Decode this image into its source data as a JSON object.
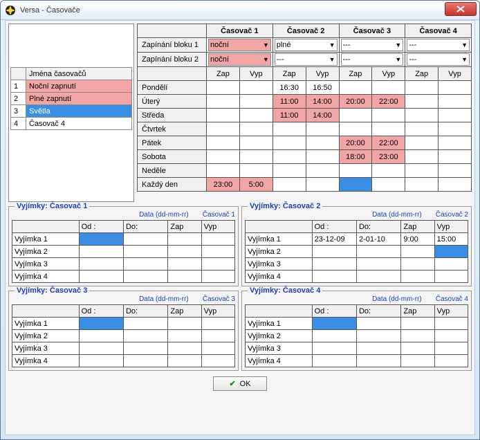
{
  "window": {
    "title": "Versa - Časovače"
  },
  "names": {
    "header": "Jména časovačů",
    "items": [
      {
        "id": "1",
        "label": "Noční zapnutí",
        "style": "red"
      },
      {
        "id": "2",
        "label": "Plné zapnutí",
        "style": "red"
      },
      {
        "id": "3",
        "label": "Světla",
        "style": "blue"
      },
      {
        "id": "4",
        "label": "Časovač 4",
        "style": ""
      }
    ]
  },
  "schedule": {
    "timers": [
      "Časovač 1",
      "Časovač 2",
      "Časovač 3",
      "Časovač 4"
    ],
    "block_rows": [
      {
        "label": "Zapínání bloku 1",
        "values": [
          "noční",
          "plné",
          "---",
          "---"
        ],
        "styles": [
          "red",
          "white",
          "white",
          "white"
        ]
      },
      {
        "label": "Zapínání bloku 2",
        "values": [
          "noční",
          "---",
          "---",
          "---"
        ],
        "styles": [
          "red",
          "white",
          "white",
          "white"
        ]
      }
    ],
    "sub_labels": [
      "Zap",
      "Vyp"
    ],
    "days": [
      {
        "name": "Pondělí",
        "cells": [
          "",
          "",
          "16:30",
          "16:50",
          "",
          "",
          "",
          ""
        ],
        "hl": [
          "",
          "",
          "",
          "",
          "",
          "",
          "",
          ""
        ]
      },
      {
        "name": "Úterý",
        "cells": [
          "",
          "",
          "11:00",
          "14:00",
          "20:00",
          "22:00",
          "",
          ""
        ],
        "hl": [
          "",
          "",
          "r",
          "r",
          "r",
          "r",
          "",
          ""
        ]
      },
      {
        "name": "Středa",
        "cells": [
          "",
          "",
          "11:00",
          "14:00",
          "",
          "",
          "",
          ""
        ],
        "hl": [
          "",
          "",
          "r",
          "r",
          "",
          "",
          "",
          ""
        ]
      },
      {
        "name": "Čtvrtek",
        "cells": [
          "",
          "",
          "",
          "",
          "",
          "",
          "",
          ""
        ],
        "hl": [
          "",
          "",
          "",
          "",
          "",
          "",
          "",
          ""
        ]
      },
      {
        "name": "Pátek",
        "cells": [
          "",
          "",
          "",
          "",
          "20:00",
          "22:00",
          "",
          ""
        ],
        "hl": [
          "",
          "",
          "",
          "",
          "r",
          "r",
          "",
          ""
        ]
      },
      {
        "name": "Sobota",
        "cells": [
          "",
          "",
          "",
          "",
          "18:00",
          "23:00",
          "",
          ""
        ],
        "hl": [
          "",
          "",
          "",
          "",
          "r",
          "r",
          "",
          ""
        ]
      },
      {
        "name": "Neděle",
        "cells": [
          "",
          "",
          "",
          "",
          "",
          "",
          "",
          ""
        ],
        "hl": [
          "",
          "",
          "",
          "",
          "",
          "",
          "",
          ""
        ]
      },
      {
        "name": "Každý den",
        "cells": [
          "23:00",
          "5:00",
          "",
          "",
          "",
          "",
          "",
          ""
        ],
        "hl": [
          "r",
          "r",
          "",
          "",
          "b",
          "",
          "",
          ""
        ]
      }
    ]
  },
  "exceptions_labels": {
    "data_header": "Data (dd-mm-rr)",
    "od": "Od :",
    "do": "Do:",
    "zap": "Zap",
    "vyp": "Vyp"
  },
  "exceptions": [
    {
      "title": "Vyjímky: Časovač 1",
      "timer": "Časovač 1",
      "rows": [
        {
          "label": "Vyjímka 1",
          "od": "",
          "do": "",
          "zap": "",
          "vyp": "",
          "sel": true
        },
        {
          "label": "Vyjímka 2"
        },
        {
          "label": "Vyjímka 3"
        },
        {
          "label": "Vyjímka 4"
        }
      ]
    },
    {
      "title": "Vyjímky: Časovač 2",
      "timer": "Časovač 2",
      "rows": [
        {
          "label": "Vyjímka 1",
          "od": "23-12-09",
          "do": "2-01-10",
          "zap": "9:00",
          "vyp": "15:00",
          "hl": true
        },
        {
          "label": "Vyjímka 2",
          "vyp_sel": true
        },
        {
          "label": "Vyjímka 3"
        },
        {
          "label": "Vyjímka 4"
        }
      ]
    },
    {
      "title": "Vyjímky: Časovač 3",
      "timer": "Časovač 3",
      "rows": [
        {
          "label": "Vyjímka 1",
          "sel": true
        },
        {
          "label": "Vyjímka 2"
        },
        {
          "label": "Vyjímka 3"
        },
        {
          "label": "Vyjímka 4"
        }
      ]
    },
    {
      "title": "Vyjímky: Časovač 4",
      "timer": "Časovač 4",
      "rows": [
        {
          "label": "Vyjímka 1",
          "sel": true
        },
        {
          "label": "Vyjímka 2"
        },
        {
          "label": "Vyjímka 3"
        },
        {
          "label": "Vyjímka 4"
        }
      ]
    }
  ],
  "ok_label": "OK"
}
